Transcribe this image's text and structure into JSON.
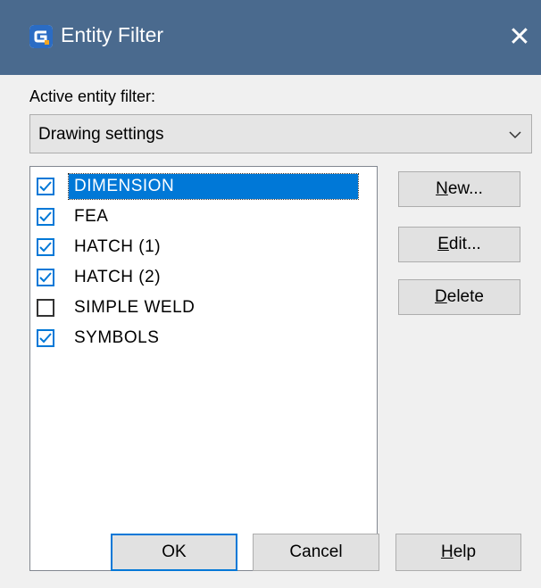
{
  "window": {
    "title": "Entity Filter",
    "close_glyph": "✕",
    "icon": "app-logo-icon",
    "titlebar_color": "#4a6a8e"
  },
  "active_filter": {
    "label": "Active entity filter:",
    "selected": "Drawing settings"
  },
  "list": {
    "items": [
      {
        "label": "DIMENSION",
        "checked": true,
        "selected": true
      },
      {
        "label": "FEA",
        "checked": true,
        "selected": false
      },
      {
        "label": "HATCH (1)",
        "checked": true,
        "selected": false
      },
      {
        "label": "HATCH (2)",
        "checked": true,
        "selected": false
      },
      {
        "label": "SIMPLE WELD",
        "checked": false,
        "selected": false
      },
      {
        "label": "SYMBOLS",
        "checked": true,
        "selected": false
      }
    ]
  },
  "buttons": {
    "new": {
      "mnemonic": "N",
      "rest": "ew..."
    },
    "edit": {
      "mnemonic": "E",
      "rest": "dit..."
    },
    "delete": {
      "mnemonic": "D",
      "rest": "elete"
    },
    "ok": "OK",
    "cancel": "Cancel",
    "help": {
      "mnemonic": "H",
      "rest": "elp"
    }
  },
  "colors": {
    "accent": "#0078d7"
  }
}
